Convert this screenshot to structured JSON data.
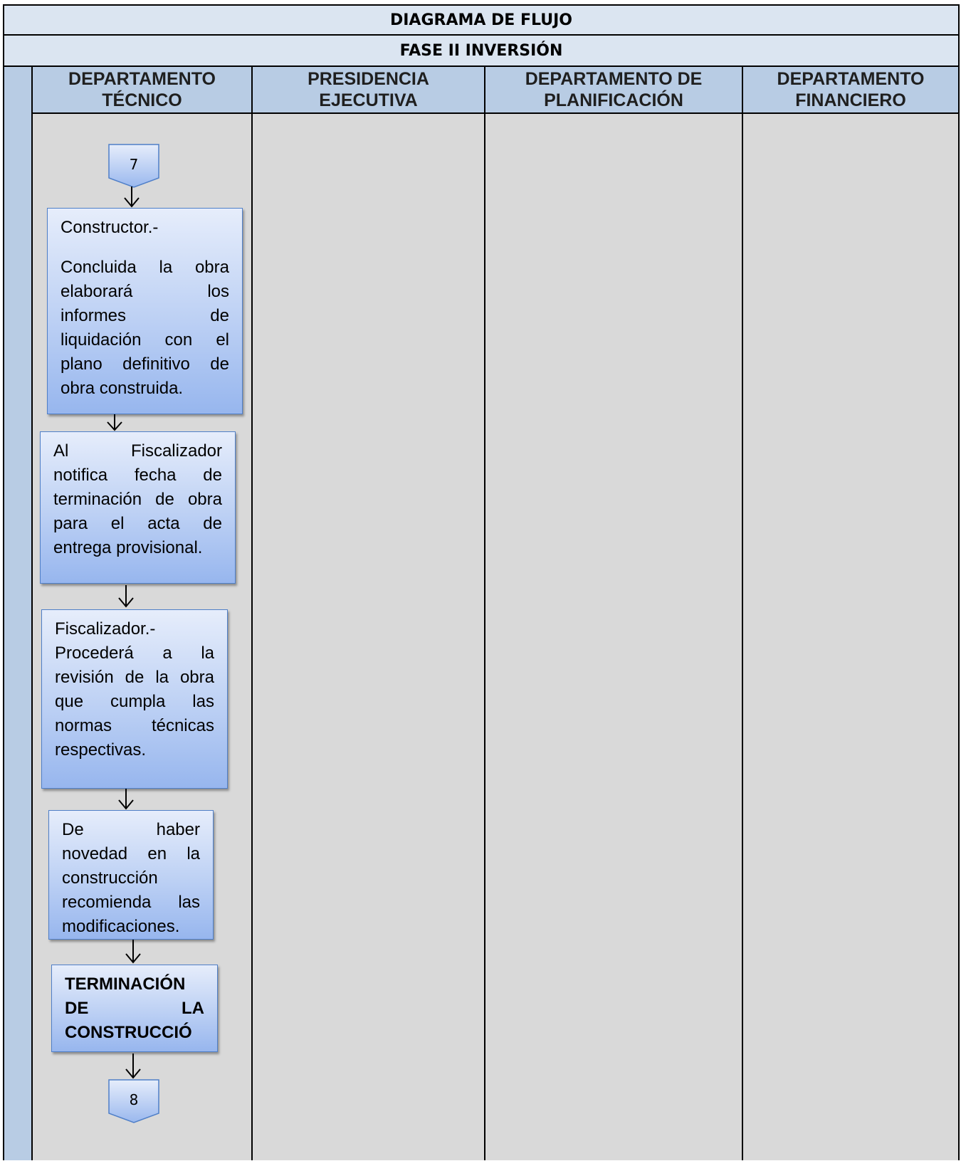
{
  "header": {
    "title": "DIAGRAMA DE FLUJO",
    "phase": "FASE II INVERSIÓN"
  },
  "columns": [
    {
      "line1": "DEPARTAMENTO",
      "line2": "TÉCNICO"
    },
    {
      "line1": "PRESIDENCIA",
      "line2": "EJECUTIVA"
    },
    {
      "line1": "DEPARTAMENTO DE",
      "line2": "PLANIFICACIÓN"
    },
    {
      "line1": "DEPARTAMENTO",
      "line2": "FINANCIERO"
    }
  ],
  "flow": {
    "start_connector": "7",
    "step1": {
      "heading": "Constructor.-",
      "text": "Concluida la obra elaborará los informes de liquidación con el plano definitivo de obra construida."
    },
    "step2": {
      "text": "Al Fiscalizador notifica fecha de terminación de obra para el acta de entrega provisional."
    },
    "step3": {
      "heading": "Fiscalizador.-",
      "text": "Procederá a la revisión de la obra que cumpla las normas técnicas respectivas."
    },
    "step4": {
      "text": "De haber novedad en la construcción recomienda las modificaciones."
    },
    "step5": {
      "text": "TERMINACIÓN DE LA CONSTRUCCIÓ"
    },
    "end_connector": "8"
  },
  "colors": {
    "header_fill": "#dbe5f1",
    "column_header_fill": "#b8cce4",
    "lane_fill": "#d9d9d9",
    "box_fill": "#bcd0f4",
    "box_border": "#4f7fc8"
  }
}
